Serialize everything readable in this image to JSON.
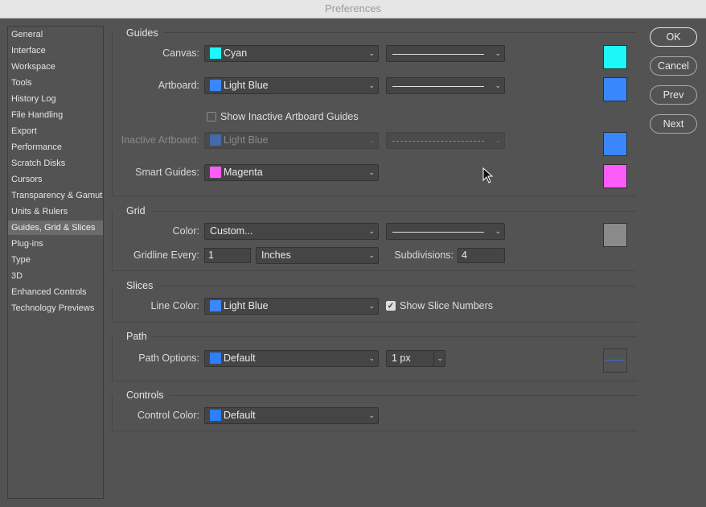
{
  "window": {
    "title": "Preferences"
  },
  "sidebar": {
    "items": [
      {
        "label": "General"
      },
      {
        "label": "Interface"
      },
      {
        "label": "Workspace"
      },
      {
        "label": "Tools"
      },
      {
        "label": "History Log"
      },
      {
        "label": "File Handling"
      },
      {
        "label": "Export"
      },
      {
        "label": "Performance"
      },
      {
        "label": "Scratch Disks"
      },
      {
        "label": "Cursors"
      },
      {
        "label": "Transparency & Gamut"
      },
      {
        "label": "Units & Rulers"
      },
      {
        "label": "Guides, Grid & Slices",
        "selected": true
      },
      {
        "label": "Plug-ins"
      },
      {
        "label": "Type"
      },
      {
        "label": "3D"
      },
      {
        "label": "Enhanced Controls"
      },
      {
        "label": "Technology Previews"
      }
    ]
  },
  "guides": {
    "title": "Guides",
    "canvas": {
      "label": "Canvas:",
      "color": "Cyan",
      "color_hex": "#1ef7f7",
      "style": "solid"
    },
    "artboard": {
      "label": "Artboard:",
      "color": "Light Blue",
      "color_hex": "#3a87fb",
      "style": "solid"
    },
    "show_inactive": {
      "label": "Show Inactive Artboard Guides",
      "checked": false
    },
    "inactive_artboard": {
      "label": "Inactive Artboard:",
      "color": "Light Blue",
      "color_hex": "#3a87fb",
      "style": "dashed",
      "disabled": true
    },
    "smart_guides": {
      "label": "Smart Guides:",
      "color": "Magenta",
      "color_hex": "#fb5cfb"
    }
  },
  "grid": {
    "title": "Grid",
    "color": {
      "label": "Color:",
      "value": "Custom...",
      "color_hex": "#8a8a8a",
      "style": "solid"
    },
    "gridline_every": {
      "label": "Gridline Every:",
      "value": "1",
      "unit": "Inches"
    },
    "subdivisions": {
      "label": "Subdivisions:",
      "value": "4"
    }
  },
  "slices": {
    "title": "Slices",
    "line_color": {
      "label": "Line Color:",
      "color": "Light Blue",
      "color_hex": "#3a87fb"
    },
    "show_numbers": {
      "label": "Show Slice Numbers",
      "checked": true
    }
  },
  "path": {
    "title": "Path",
    "options": {
      "label": "Path Options:",
      "color": "Default",
      "color_hex": "#2f7df7",
      "width": "1 px"
    }
  },
  "controls": {
    "title": "Controls",
    "control_color": {
      "label": "Control Color:",
      "color": "Default",
      "color_hex": "#2f7df7"
    }
  },
  "buttons": {
    "ok": "OK",
    "cancel": "Cancel",
    "prev": "Prev",
    "next": "Next"
  },
  "icons": {
    "chevron": "chevron-down-icon",
    "check": "checkmark-icon",
    "cursor": "mouse-pointer-icon"
  }
}
